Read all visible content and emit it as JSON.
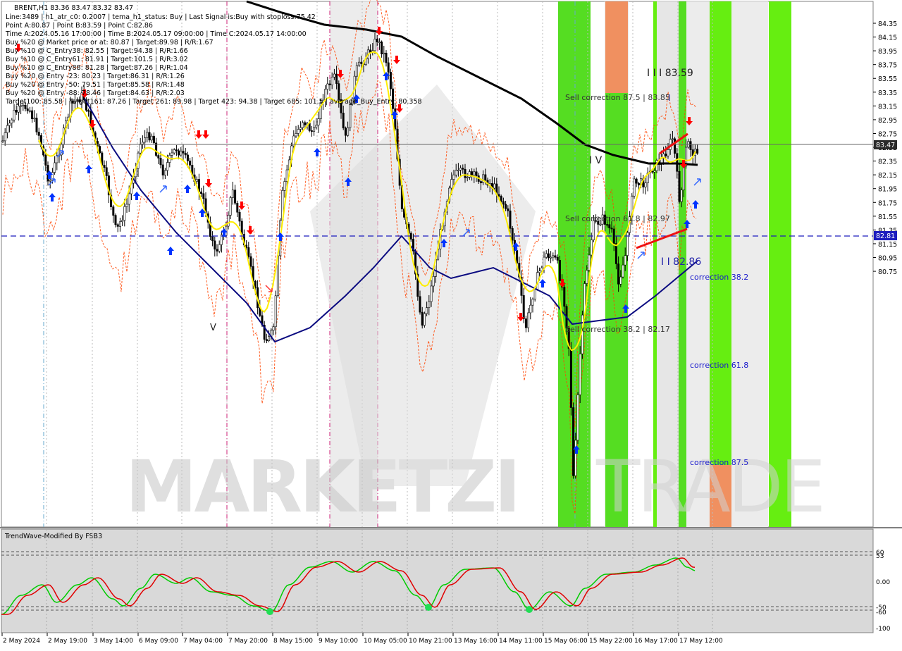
{
  "header": {
    "symbol_line": "BRENT,H1  83.36 83.47 83.32 83.47",
    "lines": [
      "Line:3489 | h1_atr_c0: 0.2007 | tema_h1_status: Buy | Last Signal is:Buy with stoploss:75.42",
      "Point A:80.87 | Point B:83.59 | Point C:82.86",
      "Time A:2024.05.16 17:00:00 | Time B:2024.05.17 09:00:00 | Time C:2024.05.17 14:00:00",
      "Buy %20 @ Market price or at: 80.87 | Target:89.98 | R/R:1.67",
      "Buy %10 @ C_Entry38: 82.55 | Target:94.38 | R/R:1.66",
      "Buy %10 @ C_Entry61: 81.91 | Target:101.5 | R/R:3.02",
      "Buy %10 @ C_Entry88: 81.28 | Target:87.26 | R/R:1.04",
      "Buy %20 @ Entry -23: 80.23 | Target:86.31 | R/R:1.26",
      "Buy %20 @ Entry -50: 79.51 | Target:85.58 | R/R:1.48",
      "Buy %20 @ Entry -88: 78.46 | Target:84.63 | R/R:2.03",
      "Target100: 85.58 | Target161: 87.26 | Target 261: 89.98 | Target 423: 94.38 | Target 685: 101.5 | average_Buy_Entry: 80.358"
    ]
  },
  "watermark": {
    "brand": "MARKETZI",
    "suffix": "TRADE"
  },
  "price_axis": {
    "ticks": [
      "84.35",
      "84.15",
      "83.95",
      "83.75",
      "83.55",
      "83.35",
      "83.15",
      "82.95",
      "82.75",
      "82.55",
      "82.35",
      "82.15",
      "81.95",
      "81.75",
      "81.55",
      "81.35",
      "81.15",
      "80.95",
      "80.75"
    ],
    "current_price": "83.47",
    "current_price_value": 83.47,
    "level_price": "82.81",
    "level_price_value": 82.81,
    "range": [
      80.7,
      84.45
    ]
  },
  "time_axis": {
    "labels": [
      "2 May 2024",
      "2 May 19:00",
      "3 May 14:00",
      "6 May 09:00",
      "7 May 04:00",
      "7 May 20:00",
      "8 May 15:00",
      "9 May 10:00",
      "10 May 05:00",
      "10 May 21:00",
      "13 May 16:00",
      "14 May 11:00",
      "15 May 06:00",
      "15 May 22:00",
      "16 May 17:00",
      "17 May 12:00"
    ]
  },
  "annotations": {
    "wave_top": "I I I 83.59",
    "wave_top_mark": "I",
    "wave_iv": "I V",
    "wave_v": "V",
    "wave_c": "I I 82.86",
    "sell_87": "Sell correction 87.5 | 83.85",
    "sell_61": "Sell correction 61.8 | 82.97",
    "sell_38": "Sell correction 38.2 | 82.17",
    "corr_382": "correction 38.2",
    "corr_618": "correction 61.8",
    "corr_875": "correction 87.5"
  },
  "indicator": {
    "title": "TrendWave-Modified By FSB3",
    "ticks": [
      "60",
      "53",
      "0.00",
      "-50",
      "-60",
      "-100"
    ],
    "line_colors": {
      "fast": "#00cc00",
      "slow": "#e00000"
    }
  },
  "colors": {
    "background": "#ffffff",
    "zone_green": "#55dd22",
    "zone_bright": "#66ee11",
    "zone_orange": "#f09060",
    "ma_black": "#000000",
    "ma_navy": "#0a0a80",
    "tema_yellow": "#ffee00",
    "bands": "#ff4400",
    "buy_arrow": "#0033ff",
    "sell_arrow": "#ff0000",
    "current_price_bg": "#2a2a2a",
    "level_bg": "#1c1cbe"
  }
}
